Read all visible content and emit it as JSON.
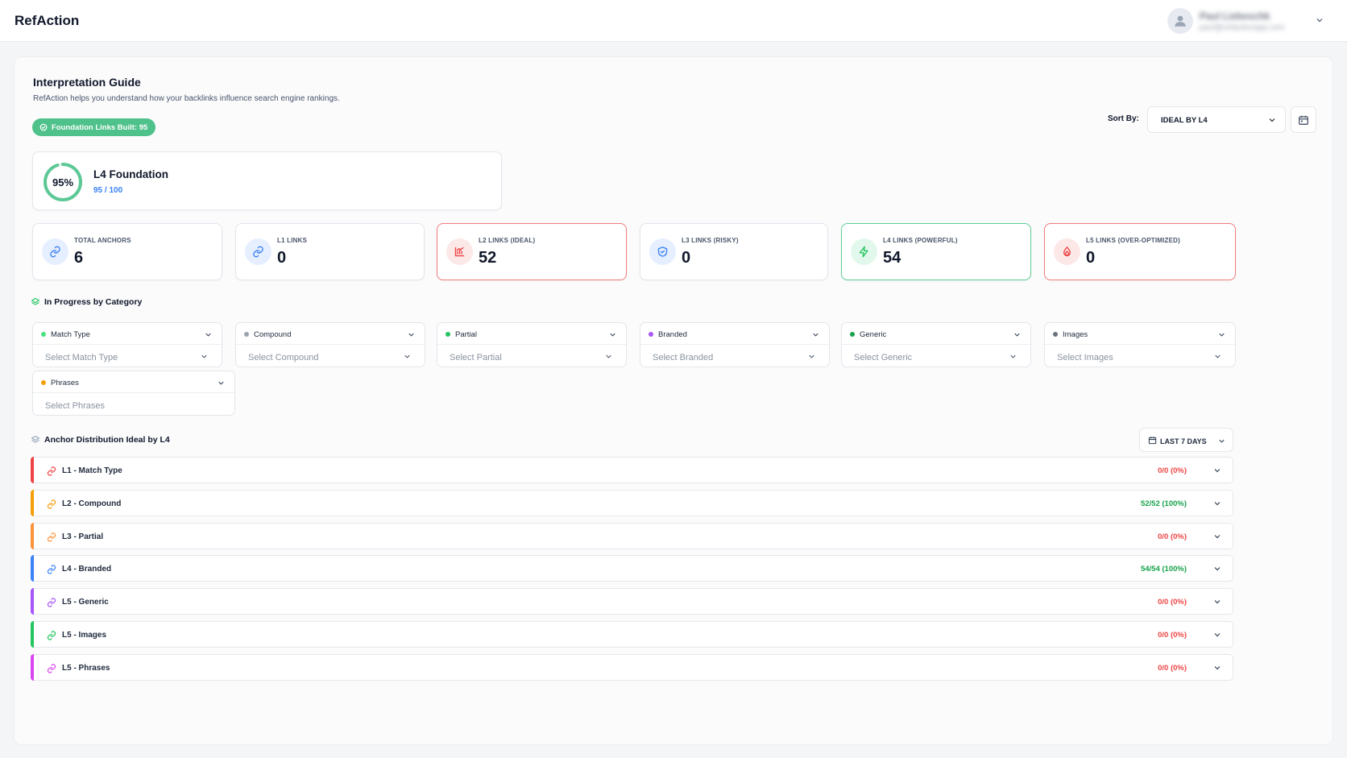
{
  "header": {
    "brand": "RefAction",
    "user_name": "Paul Liebeschk",
    "user_email": "paul@refactionapp.com"
  },
  "guide": {
    "title": "Interpretation Guide",
    "subtitle": "RefAction helps you understand how your backlinks influence search engine rankings.",
    "badge": "Foundation Links Built: 95"
  },
  "sort": {
    "label": "Sort By:",
    "value": "IDEAL BY L4"
  },
  "foundation": {
    "percent_label": "95%",
    "percent": 0.95,
    "title": "L4 Foundation",
    "progress": "95 / 100"
  },
  "stats": [
    {
      "label": "TOTAL ANCHORS",
      "value": "6",
      "icon": "link-icon",
      "color": "#3b82f6",
      "bg": "#e6efff",
      "border": "default"
    },
    {
      "label": "L1 LINKS",
      "value": "0",
      "icon": "link-icon",
      "color": "#3b82f6",
      "bg": "#e6efff",
      "border": "default"
    },
    {
      "label": "L2 LINKS (IDEAL)",
      "value": "52",
      "icon": "chart-icon",
      "color": "#ef4444",
      "bg": "#fde8e8",
      "border": "red"
    },
    {
      "label": "L3 LINKS (RISKY)",
      "value": "0",
      "icon": "shield-icon",
      "color": "#3b82f6",
      "bg": "#e6efff",
      "border": "default"
    },
    {
      "label": "L4 LINKS (POWERFUL)",
      "value": "54",
      "icon": "bolt-icon",
      "color": "#22c55e",
      "bg": "#e3f8ec",
      "border": "green"
    },
    {
      "label": "L5 LINKS (OVER-OPTIMIZED)",
      "value": "0",
      "icon": "flame-icon",
      "color": "#ef4444",
      "bg": "#fde8e8",
      "border": "red"
    }
  ],
  "categories_title": "In Progress by Category",
  "categories": [
    {
      "name": "Match Type",
      "placeholder": "Select Match Type",
      "dot": "#4ade80"
    },
    {
      "name": "Compound",
      "placeholder": "Select Compound",
      "dot": "#9ca3af"
    },
    {
      "name": "Partial",
      "placeholder": "Select Partial",
      "dot": "#22c55e"
    },
    {
      "name": "Branded",
      "placeholder": "Select Branded",
      "dot": "#a855f7"
    },
    {
      "name": "Generic",
      "placeholder": "Select Generic",
      "dot": "#16a34a"
    },
    {
      "name": "Images",
      "placeholder": "Select Images",
      "dot": "#6b7280"
    },
    {
      "name": "Phrases",
      "placeholder": "Select Phrases",
      "dot": "#f59e0b"
    }
  ],
  "distribution_title": "Anchor Distribution Ideal by L4",
  "date_range": "LAST 7 DAYS",
  "distribution": [
    {
      "label": "L1 - Match Type",
      "value": "0/0 (0%)",
      "bar": "#ef4444",
      "icon_color": "#ef4444",
      "value_color": "#ef4444"
    },
    {
      "label": "L2 - Compound",
      "value": "52/52 (100%)",
      "bar": "#f59e0b",
      "icon_color": "#f59e0b",
      "value_color": "#16a34a"
    },
    {
      "label": "L3 - Partial",
      "value": "0/0 (0%)",
      "bar": "#fb923c",
      "icon_color": "#fb923c",
      "value_color": "#ef4444"
    },
    {
      "label": "L4 - Branded",
      "value": "54/54 (100%)",
      "bar": "#3b82f6",
      "icon_color": "#3b82f6",
      "value_color": "#16a34a"
    },
    {
      "label": "L5 - Generic",
      "value": "0/0 (0%)",
      "bar": "#a855f7",
      "icon_color": "#a855f7",
      "value_color": "#ef4444"
    },
    {
      "label": "L5 - Images",
      "value": "0/0 (0%)",
      "bar": "#22c55e",
      "icon_color": "#22c55e",
      "value_color": "#ef4444"
    },
    {
      "label": "L5 - Phrases",
      "value": "0/0 (0%)",
      "bar": "#d946ef",
      "icon_color": "#d946ef",
      "value_color": "#ef4444"
    }
  ]
}
